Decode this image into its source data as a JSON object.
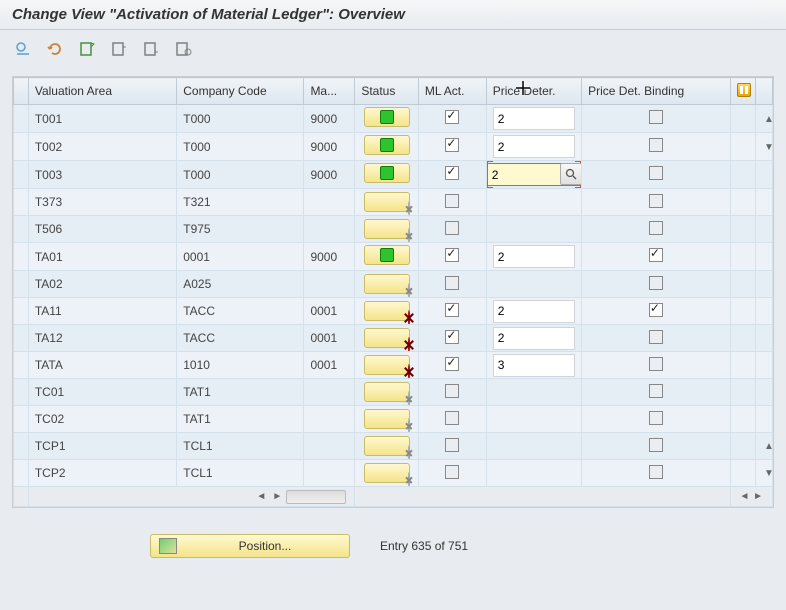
{
  "title": "Change View \"Activation of Material Ledger\": Overview",
  "toolbar": {
    "icons": [
      "edit-icon",
      "undo-icon",
      "new-icon",
      "copy-icon",
      "delete-icon",
      "export-icon"
    ]
  },
  "columns": {
    "valuation_area": "Valuation Area",
    "company_code": "Company Code",
    "material": "Ma...",
    "status": "Status",
    "ml_act": "ML Act.",
    "price_deter": "Price Deter.",
    "price_binding": "Price Det. Binding"
  },
  "rows": [
    {
      "va": "T001",
      "cc": "T000",
      "ma": "9000",
      "status": "green",
      "ml": true,
      "pd": "2",
      "bind": false
    },
    {
      "va": "T002",
      "cc": "T000",
      "ma": "9000",
      "status": "green",
      "ml": true,
      "pd": "2",
      "bind": false
    },
    {
      "va": "T003",
      "cc": "T000",
      "ma": "9000",
      "status": "green",
      "ml": true,
      "pd": "2",
      "bind": false,
      "active": true
    },
    {
      "va": "T373",
      "cc": "T321",
      "ma": "",
      "status": "grey",
      "ml": false,
      "pd": "",
      "bind": false
    },
    {
      "va": "T506",
      "cc": "T975",
      "ma": "",
      "status": "grey",
      "ml": false,
      "pd": "",
      "bind": false
    },
    {
      "va": "TA01",
      "cc": "0001",
      "ma": "9000",
      "status": "green",
      "ml": true,
      "pd": "2",
      "bind": true
    },
    {
      "va": "TA02",
      "cc": "A025",
      "ma": "",
      "status": "grey",
      "ml": false,
      "pd": "",
      "bind": false
    },
    {
      "va": "TA11",
      "cc": "TACC",
      "ma": "0001",
      "status": "red",
      "ml": true,
      "pd": "2",
      "bind": true
    },
    {
      "va": "TA12",
      "cc": "TACC",
      "ma": "0001",
      "status": "red",
      "ml": true,
      "pd": "2",
      "bind": false
    },
    {
      "va": "TATA",
      "cc": "1010",
      "ma": "0001",
      "status": "red",
      "ml": true,
      "pd": "3",
      "bind": false
    },
    {
      "va": "TC01",
      "cc": "TAT1",
      "ma": "",
      "status": "grey",
      "ml": false,
      "pd": "",
      "bind": false
    },
    {
      "va": "TC02",
      "cc": "TAT1",
      "ma": "",
      "status": "grey",
      "ml": false,
      "pd": "",
      "bind": false
    },
    {
      "va": "TCP1",
      "cc": "TCL1",
      "ma": "",
      "status": "grey",
      "ml": false,
      "pd": "",
      "bind": false
    },
    {
      "va": "TCP2",
      "cc": "TCL1",
      "ma": "",
      "status": "grey",
      "ml": false,
      "pd": "",
      "bind": false
    }
  ],
  "footer": {
    "position_label": "Position...",
    "entry_text": "Entry 635 of 751"
  }
}
